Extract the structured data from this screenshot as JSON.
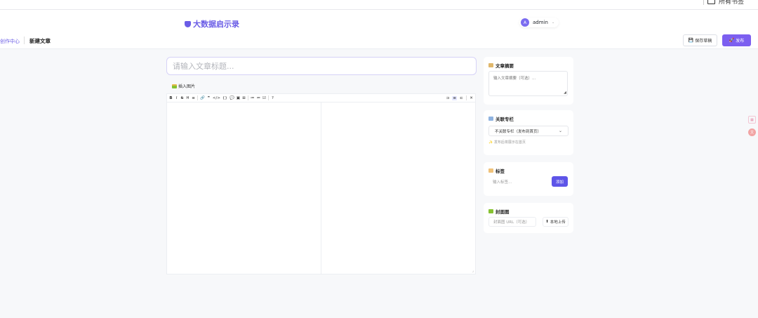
{
  "system_bar": {
    "label": "所有书签"
  },
  "header": {
    "logo_text": "大数据启示录",
    "user": {
      "avatar_letter": "A",
      "name": "admin"
    }
  },
  "subbar": {
    "back_label": "创作中心",
    "page_title": "新建文章",
    "save_draft_label": "保存草稿",
    "publish_label": "发布"
  },
  "editor": {
    "title_placeholder": "请输入文章标题...",
    "insert_image_label": "插入图片",
    "toolbar_left": [
      "B",
      "I",
      "S",
      "H",
      "≡",
      "🔗",
      "❞",
      "</>",
      "{}",
      "💬",
      "▣",
      "⊞",
      "≔",
      "≔",
      "☑",
      "?"
    ],
    "toolbar_right": [
      "⊐",
      "≡",
      "⊏",
      "✕"
    ]
  },
  "sidebar": {
    "summary": {
      "title": "文章摘要",
      "placeholder": "输入文章摘要（可选）..."
    },
    "column": {
      "title": "关联专栏",
      "selected": "不关联专栏（发布到首页）",
      "hint": "发布后将展示在首页"
    },
    "tags": {
      "title": "标签",
      "placeholder": "输入标签...",
      "add_label": "添加"
    },
    "cover": {
      "title": "封面图",
      "url_placeholder": "封面图 URL（可选）",
      "upload_label": "本地上传"
    }
  },
  "colors": {
    "accent": "#6a5ce6",
    "publish": "#7c5ff0",
    "background": "#f7f8fa"
  }
}
